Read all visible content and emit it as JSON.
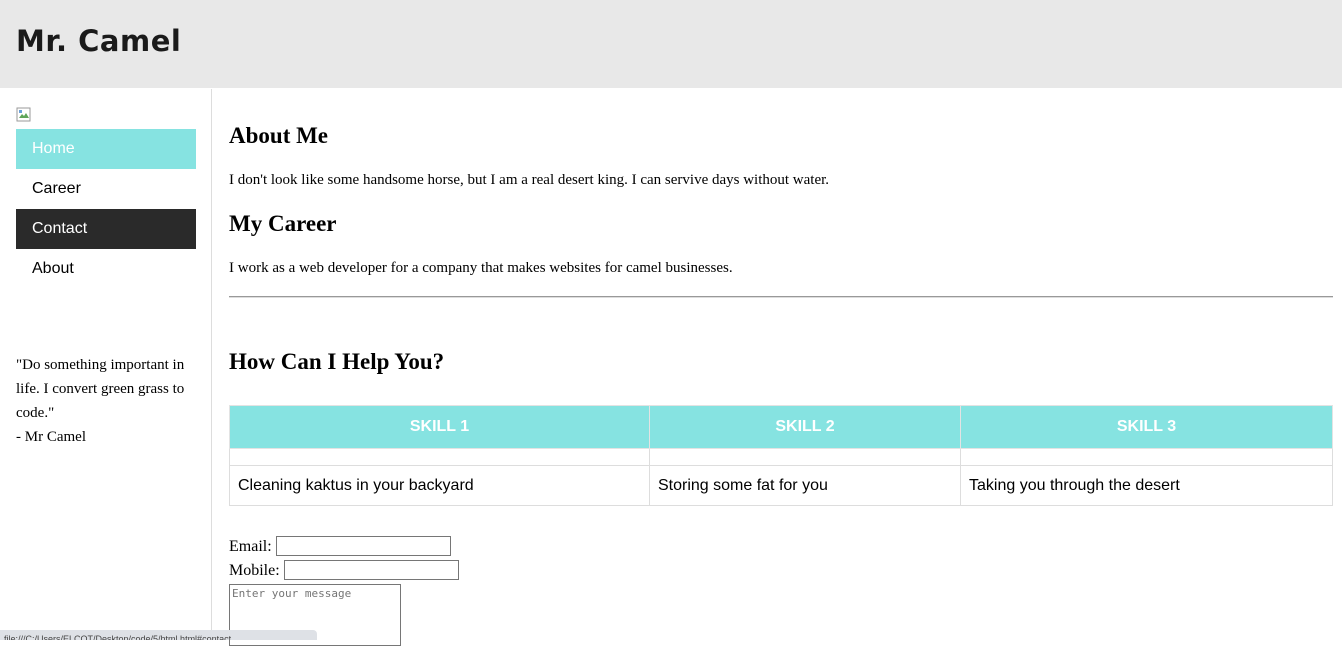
{
  "header": {
    "title": "Mr. Camel"
  },
  "sidebar": {
    "nav": [
      {
        "label": "Home"
      },
      {
        "label": "Career"
      },
      {
        "label": "Contact"
      },
      {
        "label": "About"
      }
    ],
    "quote": {
      "text": "\"Do something important in life. I convert green grass to code.\"",
      "author": "- Mr Camel"
    }
  },
  "main": {
    "about": {
      "heading": "About Me",
      "text": "I don't look like some handsome horse, but I am a real desert king. I can servive days without water."
    },
    "career": {
      "heading": "My Career",
      "text": "I work as a web developer for a company that makes websites for camel businesses."
    },
    "help": {
      "heading": "How Can I Help You?"
    },
    "skills": {
      "headers": [
        "SKILL 1",
        "SKILL 2",
        "SKILL 3"
      ],
      "rows": [
        [
          "Cleaning kaktus in your backyard",
          "Storing some fat for you",
          "Taking you through the desert"
        ]
      ]
    },
    "form": {
      "email_label": "Email:",
      "mobile_label": "Mobile:",
      "email_value": "",
      "mobile_value": "",
      "message_placeholder": "Enter your message"
    }
  },
  "status_bar": {
    "url": "file:///C:/Users/ELCOT/Desktop/code/5/html.html#contact"
  },
  "colors": {
    "accent": "#86e3e1",
    "dark_nav": "#2a2a2a",
    "header_bg": "#e8e8e8"
  }
}
